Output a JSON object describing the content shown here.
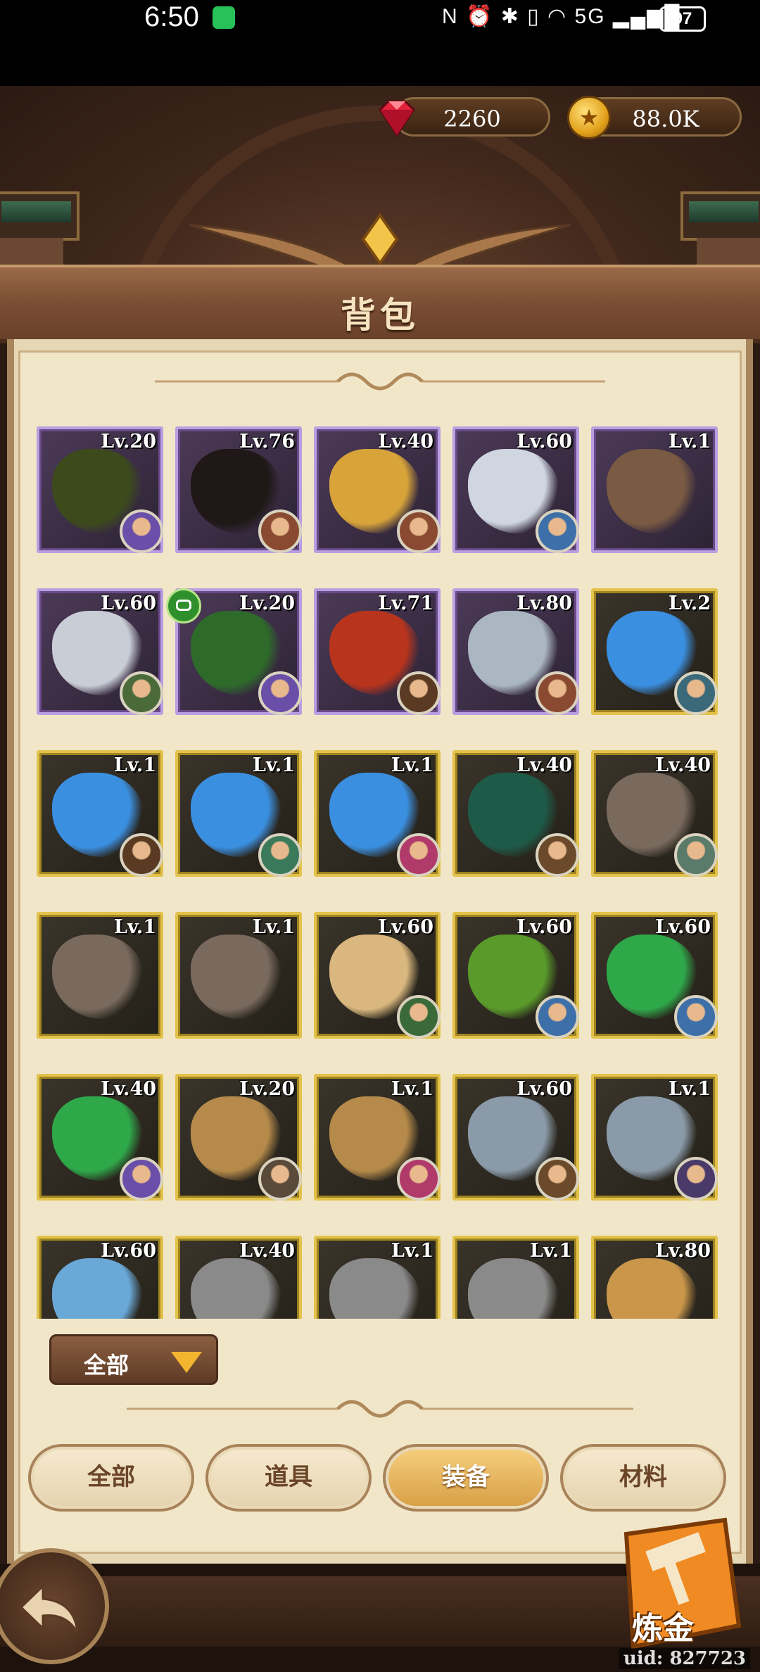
{
  "status_bar": {
    "time": "6:50",
    "indicators": "N ⏰ ✱ ▯ ◠ 5G ▂▄▆█",
    "battery": "97"
  },
  "currency": {
    "gems": "2260",
    "gold": "88.0K"
  },
  "page": {
    "title": "背包"
  },
  "filter": {
    "label": "全部"
  },
  "tabs": [
    {
      "label": "全部",
      "active": false
    },
    {
      "label": "道具",
      "active": false
    },
    {
      "label": "装备",
      "active": true
    },
    {
      "label": "材料",
      "active": false
    }
  ],
  "alchemy_label": "炼金",
  "uid": "uid: 827723",
  "items": [
    {
      "lv": "Lv.20",
      "rarity": "purple",
      "kind": "thorn-ring-icon",
      "color": "#3c4a1c",
      "hero": "#6a4fa8"
    },
    {
      "lv": "Lv.76",
      "rarity": "purple",
      "kind": "dark-horse-icon",
      "color": "#1f1816",
      "hero": "#8a4a32"
    },
    {
      "lv": "Lv.40",
      "rarity": "purple",
      "kind": "skull-helm-icon",
      "color": "#d8a43a",
      "hero": "#8a4a32"
    },
    {
      "lv": "Lv.60",
      "rarity": "purple",
      "kind": "white-armor-icon",
      "color": "#cfd6e0",
      "hero": "#3d6fa8"
    },
    {
      "lv": "Lv.1",
      "rarity": "purple",
      "kind": "leather-armor-icon",
      "color": "#7a5a42",
      "hero": ""
    },
    {
      "lv": "Lv.60",
      "rarity": "purple",
      "kind": "gold-armor-icon",
      "color": "#c9cdd6",
      "hero": "#4a6a3a"
    },
    {
      "lv": "Lv.20",
      "rarity": "purple",
      "kind": "thorn-gem-icon",
      "color": "#2e6a2a",
      "hero": "#6a4fa8"
    },
    {
      "lv": "Lv.71",
      "rarity": "purple",
      "kind": "red-bow-icon",
      "color": "#b8341c",
      "hero": "#5a3a22"
    },
    {
      "lv": "Lv.80",
      "rarity": "purple",
      "kind": "bone-bow-icon",
      "color": "#aab6c2",
      "hero": "#8a4a32"
    },
    {
      "lv": "Lv.2",
      "rarity": "gold",
      "kind": "blue-crystal-icon",
      "color": "#3b8fe0",
      "hero": "#3a6a7a"
    },
    {
      "lv": "Lv.1",
      "rarity": "gold",
      "kind": "blue-crystal-icon",
      "color": "#3b8fe0",
      "hero": "#5a3a22"
    },
    {
      "lv": "Lv.1",
      "rarity": "gold",
      "kind": "blue-crystal-icon",
      "color": "#3b8fe0",
      "hero": "#3a7a5a"
    },
    {
      "lv": "Lv.1",
      "rarity": "gold",
      "kind": "blue-crystal-icon",
      "color": "#3b8fe0",
      "hero": "#b03a6a"
    },
    {
      "lv": "Lv.40",
      "rarity": "gold",
      "kind": "green-cloak-icon",
      "color": "#1e5a48",
      "hero": "#6a4a2a"
    },
    {
      "lv": "Lv.40",
      "rarity": "gold",
      "kind": "stone-gauntlet-icon",
      "color": "#7a6a5e",
      "hero": "#5a7a6a"
    },
    {
      "lv": "Lv.1",
      "rarity": "gold",
      "kind": "stone-gauntlet-icon",
      "color": "#7a6a5e",
      "hero": ""
    },
    {
      "lv": "Lv.1",
      "rarity": "gold",
      "kind": "stone-gauntlet-icon",
      "color": "#7a6a5e",
      "hero": ""
    },
    {
      "lv": "Lv.60",
      "rarity": "gold",
      "kind": "map-scroll-icon",
      "color": "#d9b77e",
      "hero": "#3a6a3a"
    },
    {
      "lv": "Lv.60",
      "rarity": "gold",
      "kind": "turtle-shell-icon",
      "color": "#5a9a2a",
      "hero": "#3d6fa8"
    },
    {
      "lv": "Lv.60",
      "rarity": "gold",
      "kind": "emerald-bracelet-icon",
      "color": "#2fa84a",
      "hero": "#3d6fa8"
    },
    {
      "lv": "Lv.40",
      "rarity": "gold",
      "kind": "emerald-bracelet-icon",
      "color": "#2fa84a",
      "hero": "#6a4fa8"
    },
    {
      "lv": "Lv.20",
      "rarity": "gold",
      "kind": "horn-helm-icon",
      "color": "#b58a4a",
      "hero": "#5a4a3a"
    },
    {
      "lv": "Lv.1",
      "rarity": "gold",
      "kind": "horn-helm-icon",
      "color": "#b58a4a",
      "hero": "#b03a6a"
    },
    {
      "lv": "Lv.60",
      "rarity": "gold",
      "kind": "spiked-pauldron-icon",
      "color": "#8a9aa8",
      "hero": "#6a4a2a"
    },
    {
      "lv": "Lv.1",
      "rarity": "gold",
      "kind": "spiked-pauldron-icon",
      "color": "#8a9aa8",
      "hero": "#4a3a6a"
    },
    {
      "lv": "Lv.60",
      "rarity": "gold",
      "kind": "ice-helm-icon",
      "color": "#6aa8d8",
      "hero": ""
    },
    {
      "lv": "Lv.40",
      "rarity": "gold",
      "kind": "iron-helm-icon",
      "color": "#8a8a8a",
      "hero": ""
    },
    {
      "lv": "Lv.1",
      "rarity": "gold",
      "kind": "iron-helm-icon",
      "color": "#8a8a8a",
      "hero": ""
    },
    {
      "lv": "Lv.1",
      "rarity": "gold",
      "kind": "iron-helm-icon",
      "color": "#8a8a8a",
      "hero": ""
    },
    {
      "lv": "Lv.80",
      "rarity": "gold",
      "kind": "sand-cloak-icon",
      "color": "#c9964a",
      "hero": ""
    }
  ]
}
